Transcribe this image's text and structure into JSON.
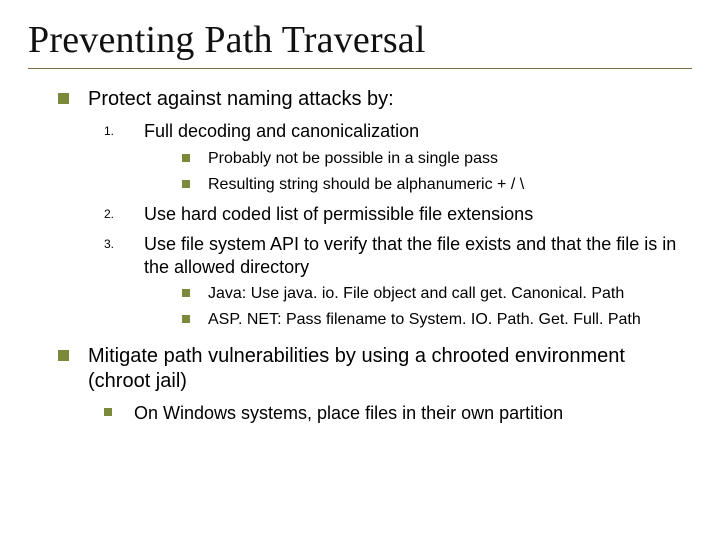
{
  "title": "Preventing Path Traversal",
  "top1": {
    "text": "Protect against naming attacks by:",
    "items": [
      {
        "num": "1.",
        "text": "Full decoding and canonicalization",
        "subs": [
          "Probably not be possible in a single pass",
          "Resulting string should be alphanumeric + /  \\"
        ]
      },
      {
        "num": "2.",
        "text": "Use hard coded list of permissible file extensions",
        "subs": []
      },
      {
        "num": "3.",
        "text": "Use file system API to verify that the file exists and that the file is in the allowed directory",
        "subs": [
          "Java: Use java. io. File object and call get. Canonical. Path",
          "ASP. NET: Pass filename to System. IO. Path. Get. Full. Path"
        ]
      }
    ]
  },
  "top2": {
    "text": "Mitigate path vulnerabilities by using a chrooted environment (chroot jail)",
    "subs": [
      "On Windows systems, place files in their own partition"
    ]
  }
}
